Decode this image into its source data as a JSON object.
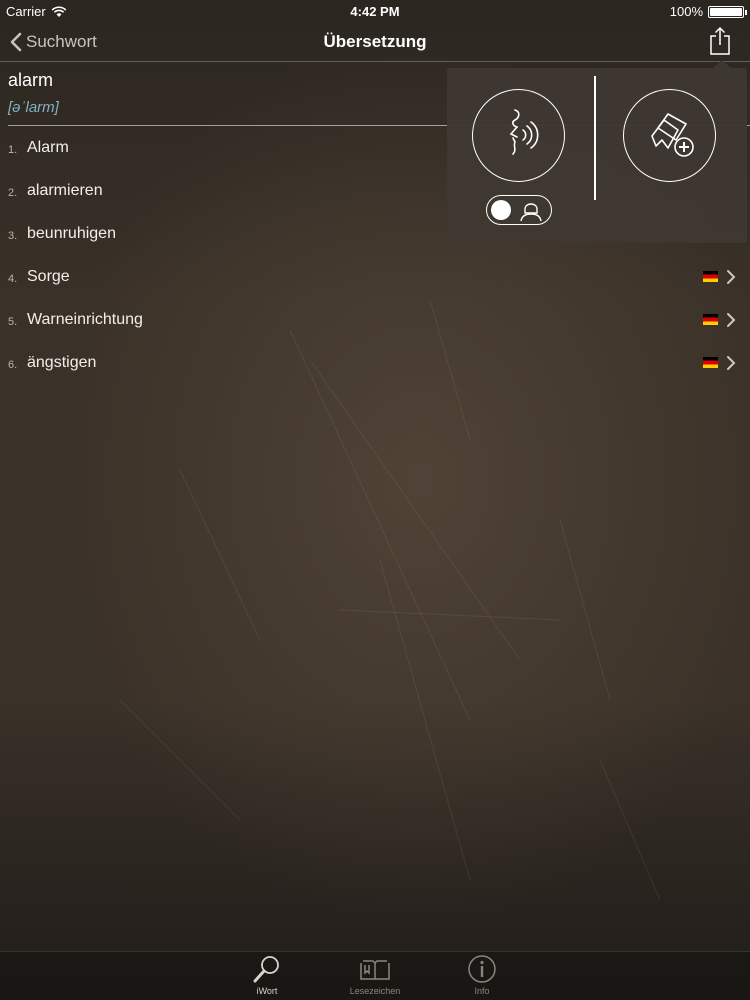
{
  "status_bar": {
    "carrier": "Carrier",
    "time": "4:42 PM",
    "battery": "100%"
  },
  "nav": {
    "back_label": "Suchwort",
    "title": "Übersetzung",
    "share_icon": "share-icon"
  },
  "entry": {
    "headword": "alarm",
    "phonetic": "[əˈlarm]"
  },
  "translations": [
    {
      "index": "1.",
      "text": "Alarm",
      "has_flag": false
    },
    {
      "index": "2.",
      "text": "alarmieren",
      "has_flag": false
    },
    {
      "index": "3.",
      "text": "beunruhigen",
      "has_flag": false
    },
    {
      "index": "4.",
      "text": "Sorge",
      "has_flag": true
    },
    {
      "index": "5.",
      "text": "Warneinrichtung",
      "has_flag": true
    },
    {
      "index": "6.",
      "text": "ängstigen",
      "has_flag": true
    }
  ],
  "popover": {
    "speak_icon": "speak-icon",
    "bookmark_add_icon": "bookmark-add-icon",
    "voice_toggle_icon": "female-voice-icon"
  },
  "tab_bar": {
    "items": [
      {
        "label": "iWort",
        "icon": "search-icon",
        "active": true
      },
      {
        "label": "Lesezeichen",
        "icon": "book-icon",
        "active": false
      },
      {
        "label": "Info",
        "icon": "info-icon",
        "active": false
      }
    ]
  },
  "colors": {
    "accent_phonetic": "#7fb3c8",
    "flag_black": "#000000",
    "flag_red": "#dd0000",
    "flag_gold": "#ffce00"
  }
}
